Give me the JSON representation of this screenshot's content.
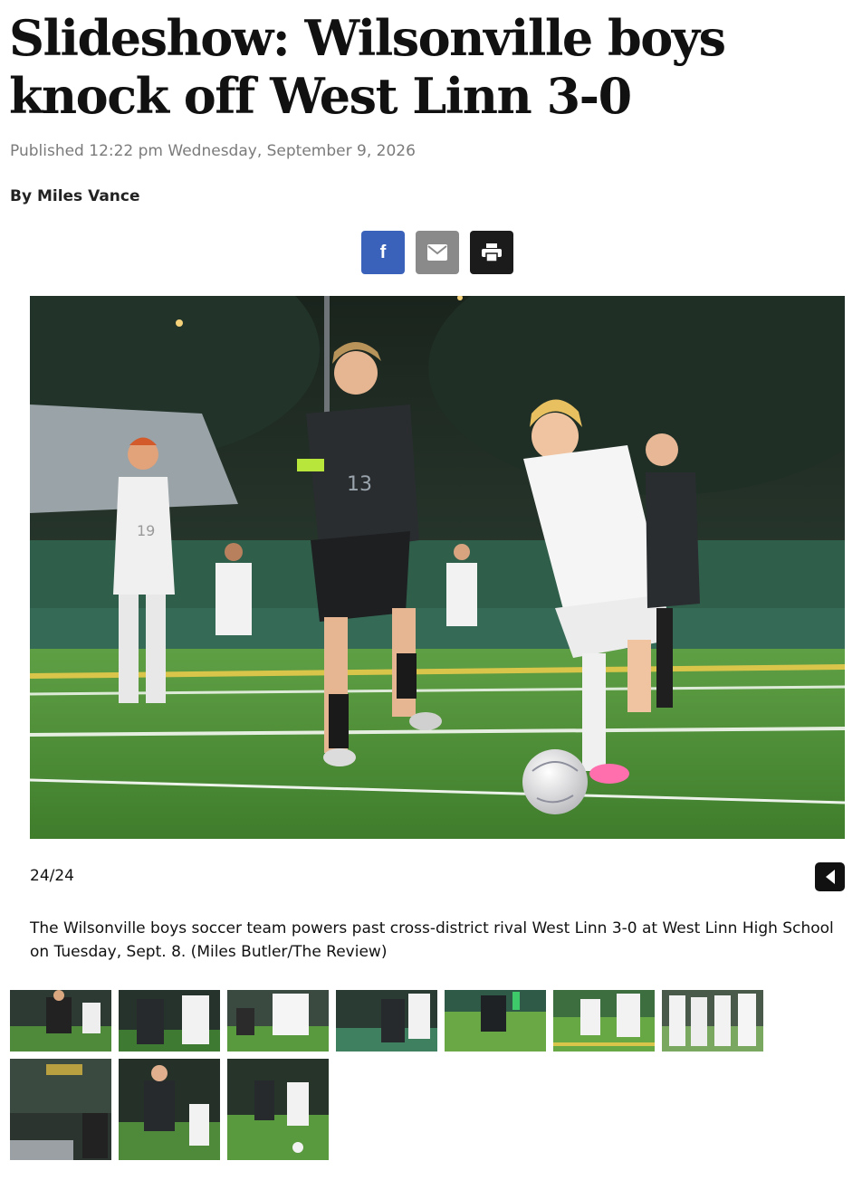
{
  "article": {
    "headline": "Slideshow: Wilsonville boys knock off West Linn 3-0",
    "published": "Published 12:22 pm Wednesday, September 9, 2026",
    "byline": "By Miles Vance"
  },
  "share": {
    "facebook_label": "f",
    "buttons": [
      "facebook-icon",
      "email-icon",
      "print-icon"
    ],
    "colors": {
      "facebook": "#3b62bb",
      "email": "#8a8a8a",
      "print": "#1b1b1b"
    }
  },
  "slideshow": {
    "counter": "24/24",
    "caption": "The Wilsonville boys soccer team powers past cross-district rival West Linn 3-0 at West Linn High School on Tuesday, Sept. 8. (Miles Butler/The Review)",
    "jersey_numbers": [
      "13",
      "19"
    ],
    "thumbnail_count": 10
  }
}
